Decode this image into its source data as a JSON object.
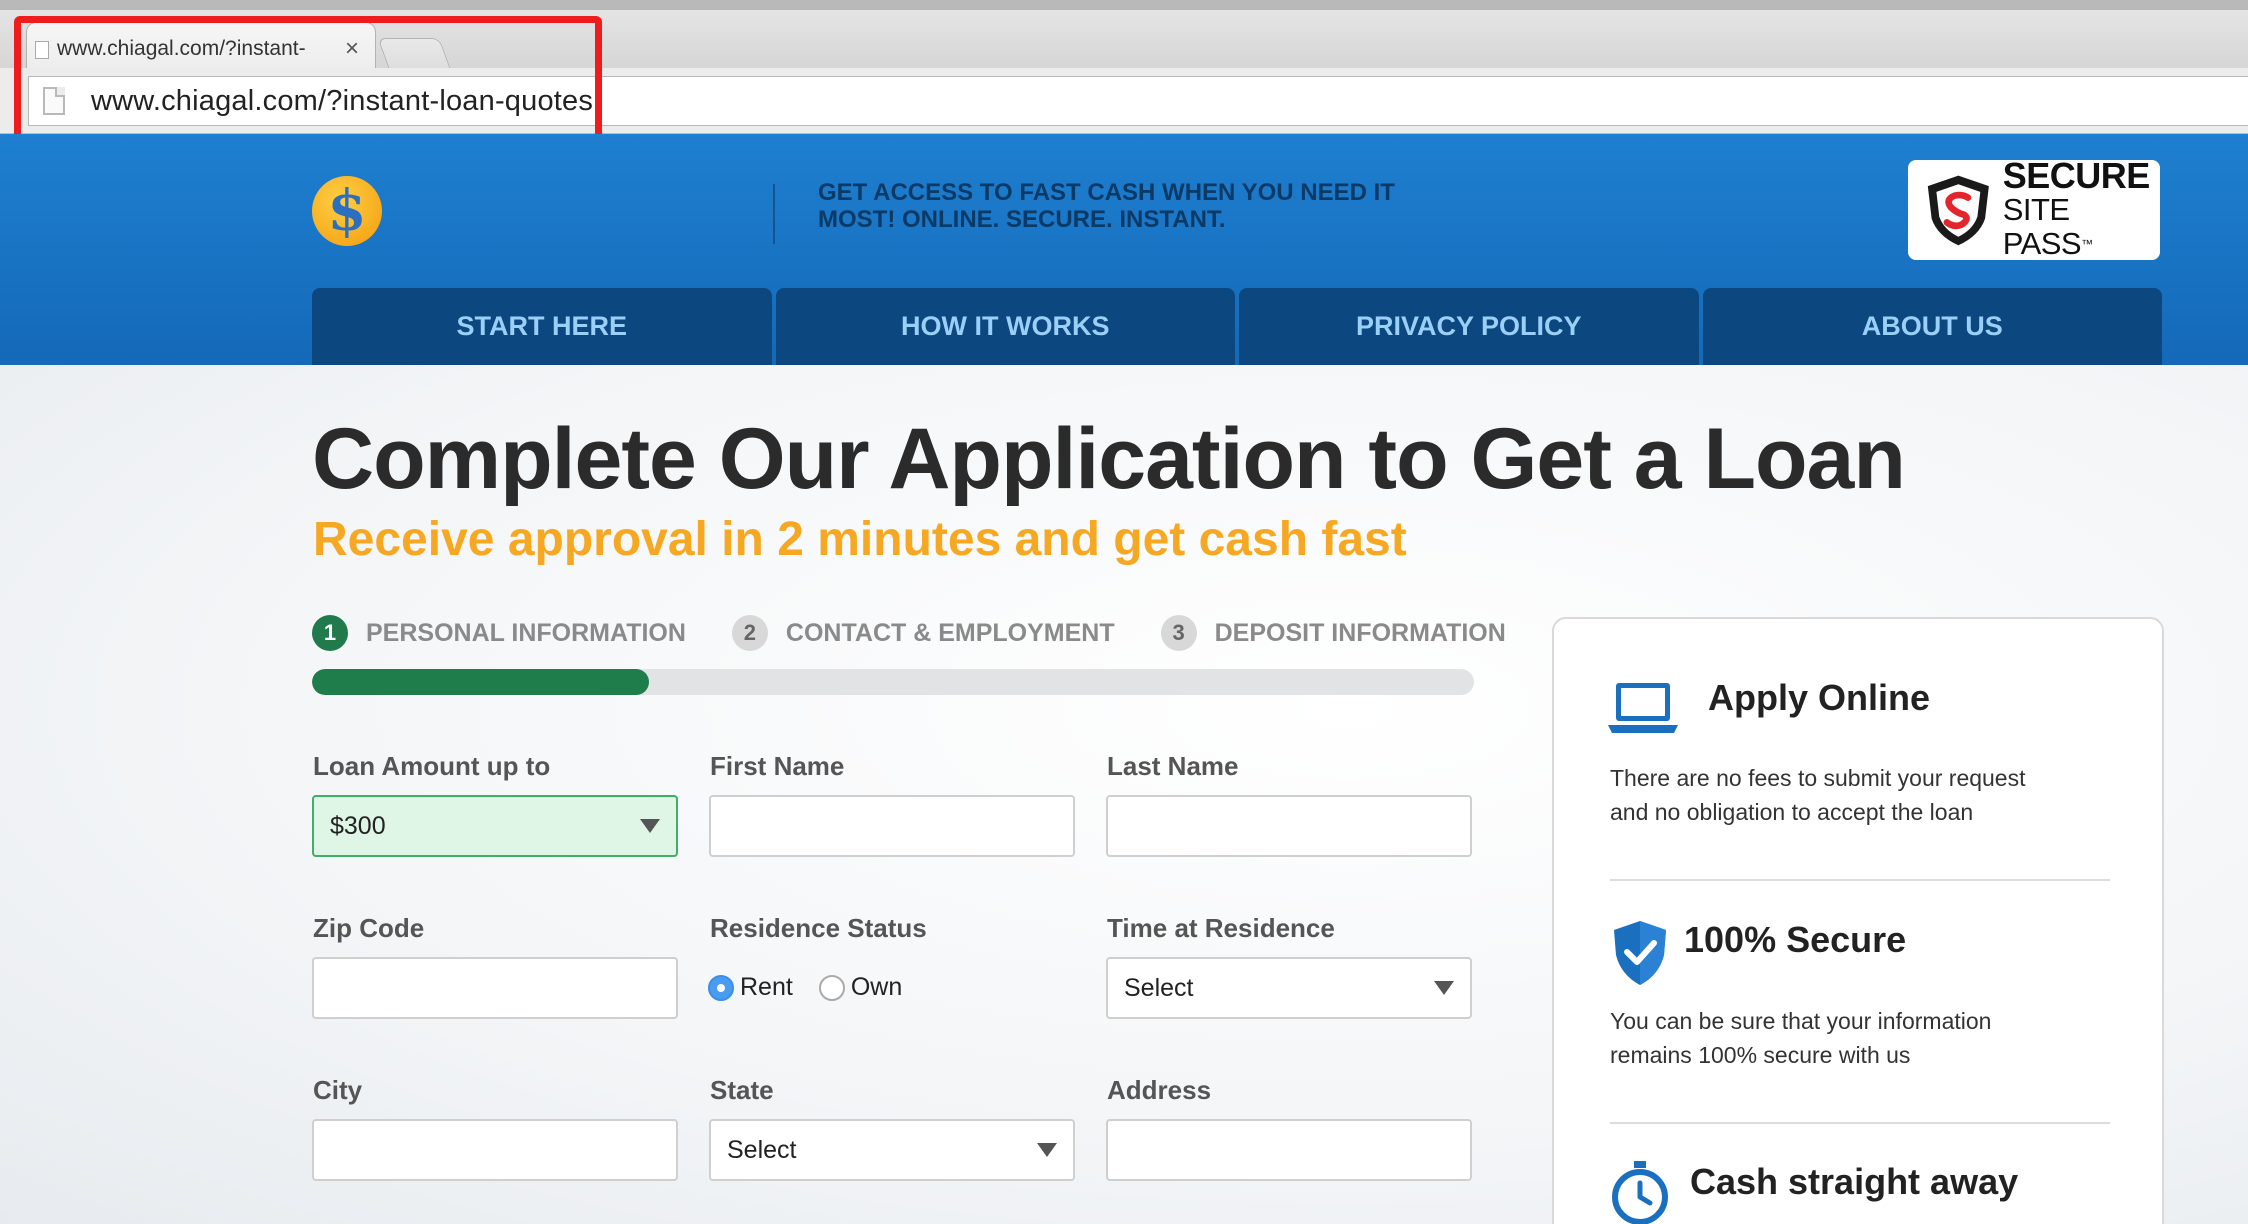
{
  "browser": {
    "tab_title": "www.chiagal.com/?instant-",
    "tab_close": "×",
    "url": "www.chiagal.com/?instant-loan-quotes"
  },
  "header": {
    "logo_symbol": "$",
    "tagline": "GET ACCESS TO FAST CASH WHEN YOU NEED IT MOST! ONLINE. SECURE. INSTANT.",
    "badge_line1": "SECURE",
    "badge_line2": "SITE PASS",
    "badge_tm": "™"
  },
  "nav": {
    "items": [
      {
        "label": "START HERE"
      },
      {
        "label": "HOW IT WORKS"
      },
      {
        "label": "PRIVACY POLICY"
      },
      {
        "label": "ABOUT US"
      }
    ]
  },
  "main": {
    "title": "Complete Our Application to Get a Loan",
    "subtitle": "Receive approval in 2 minutes and get cash fast"
  },
  "steps": [
    {
      "num": "1",
      "label": "PERSONAL INFORMATION",
      "active": true
    },
    {
      "num": "2",
      "label": "CONTACT & EMPLOYMENT",
      "active": false
    },
    {
      "num": "3",
      "label": "DEPOSIT INFORMATION",
      "active": false
    }
  ],
  "progress": {
    "fraction": 0.29
  },
  "form": {
    "loan_amount_label": "Loan Amount up to",
    "loan_amount_value": "$300",
    "first_name_label": "First Name",
    "first_name_value": "",
    "last_name_label": "Last Name",
    "last_name_value": "",
    "zip_label": "Zip Code",
    "zip_value": "",
    "residence_status_label": "Residence Status",
    "residence_options": [
      "Rent",
      "Own"
    ],
    "residence_selected": "Rent",
    "time_at_residence_label": "Time at Residence",
    "time_at_residence_value": "Select",
    "city_label": "City",
    "city_value": "",
    "state_label": "State",
    "state_value": "Select",
    "address_label": "Address",
    "address_value": ""
  },
  "sidebar": {
    "features": [
      {
        "title": "Apply Online",
        "text": "There are no fees to submit your request and no obligation to accept the loan",
        "icon": "laptop-icon"
      },
      {
        "title": "100% Secure",
        "text": "You can be sure that your information remains 100% secure with us",
        "icon": "shield-check-icon"
      },
      {
        "title": "Cash straight away",
        "text": "",
        "icon": "stopwatch-icon"
      }
    ]
  },
  "colors": {
    "header_blue": "#1f7fd0",
    "nav_blue": "#0c4780",
    "nav_text": "#9ad0f7",
    "accent_orange": "#f6a823",
    "progress_green": "#1f7d4b",
    "highlight_red": "#ee1c1c"
  }
}
